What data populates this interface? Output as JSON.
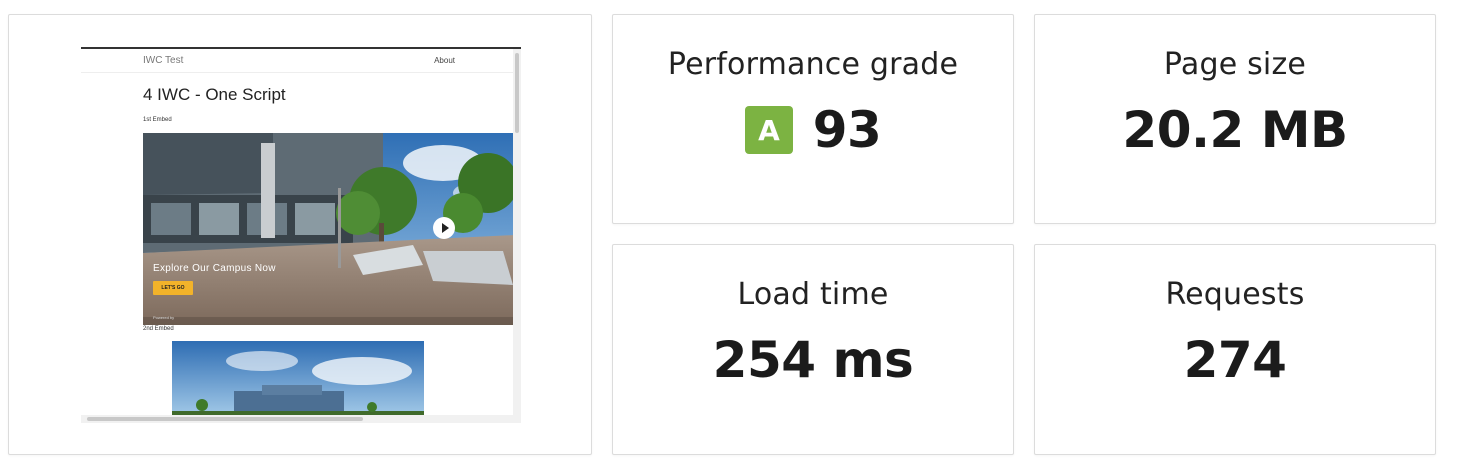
{
  "screenshot": {
    "site_title": "IWC Test",
    "nav_about": "About",
    "page_heading": "4 IWC - One Script",
    "embed1_label": "1st Embed",
    "embed1_caption": "Explore Our Campus Now",
    "embed1_button": "LET'S GO",
    "embed1_powered": "Powered by",
    "embed2_label": "2nd Embed"
  },
  "metrics": {
    "performance": {
      "label": "Performance grade",
      "grade": "A",
      "value": "93",
      "grade_color": "#7cb342"
    },
    "page_size": {
      "label": "Page size",
      "value": "20.2 MB"
    },
    "load_time": {
      "label": "Load time",
      "value": "254 ms"
    },
    "requests": {
      "label": "Requests",
      "value": "274"
    }
  }
}
